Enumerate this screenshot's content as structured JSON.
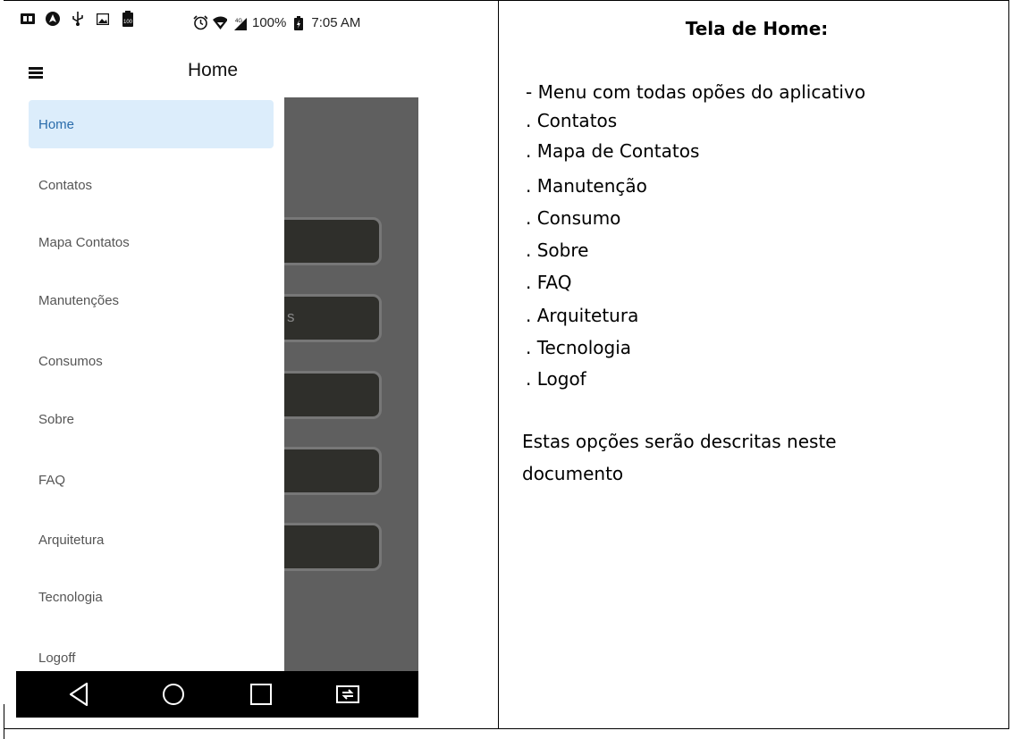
{
  "phone": {
    "status_bar": {
      "left_icons": [
        "sim-icon",
        "navigation-icon",
        "usb-icon",
        "image-icon",
        "battery-100-icon"
      ],
      "right_icons": [
        "alarm-icon",
        "wifi-icon",
        "signal-4g-icon"
      ],
      "battery_percent": "100%",
      "time": "7:05 AM"
    },
    "app_bar": {
      "title": "Home"
    },
    "drawer": {
      "items": [
        {
          "label": "Home",
          "active": true
        },
        {
          "label": "Contatos"
        },
        {
          "label": "Mapa Contatos"
        },
        {
          "label": "Manutenções"
        },
        {
          "label": "Consumos"
        },
        {
          "label": "Sobre"
        },
        {
          "label": "FAQ"
        },
        {
          "label": "Arquitetura"
        },
        {
          "label": "Tecnologia"
        },
        {
          "label": "Logoff"
        }
      ]
    },
    "background_partial_text": "s",
    "nav_bar": [
      "back-icon",
      "home-circle-icon",
      "recent-apps-icon",
      "screen-switch-icon"
    ],
    "colors": {
      "drawer_active_bg": "#dcedfb",
      "drawer_active_text": "#2a6cab",
      "scrim": "#5f5f5f"
    }
  },
  "doc": {
    "title": "Tela de Home:",
    "intro": "- Menu com todas opões do aplicativo",
    "options": [
      ". Contatos",
      ". Mapa de Contatos",
      ". Manutenção",
      ". Consumo",
      ". Sobre",
      ". FAQ",
      ". Arquitetura",
      ". Tecnologia",
      ". Logof"
    ],
    "footer_line1": "Estas opções serão descritas neste",
    "footer_line2": "documento"
  }
}
